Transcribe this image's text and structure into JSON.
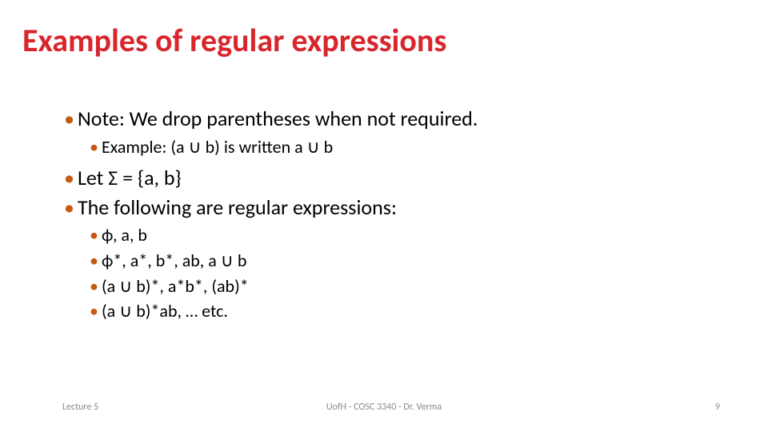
{
  "title": "Examples of regular expressions",
  "lines": {
    "l1": "Note: We  drop parentheses when not required.",
    "l1a": "Example: (a ∪ b) is written a ∪ b",
    "l2": "Let Σ = {a, b}",
    "l3": "The following are regular expressions:",
    "l3a": "ϕ, a, b",
    "l3b": "ϕ*, a*, b*, ab, a ∪ b",
    "l3c": "(a ∪ b)*, a*b*, (ab)*",
    "l3d": "(a ∪ b)*ab, … etc."
  },
  "footer": {
    "left": "Lecture 5",
    "center": "UofH - COSC 3340 - Dr. Verma",
    "right": "9"
  }
}
